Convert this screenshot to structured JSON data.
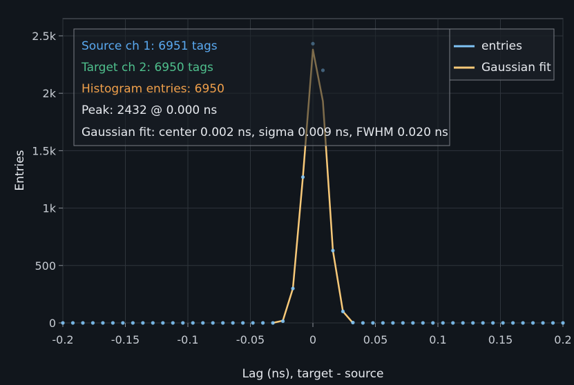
{
  "chart_data": {
    "type": "line",
    "title": "",
    "xlabel": "Lag (ns), target - source",
    "ylabel": "Entries",
    "xlim": [
      -0.2,
      0.2
    ],
    "ylim": [
      0,
      2650
    ],
    "grid": true,
    "x_ticks": [
      -0.2,
      -0.15,
      -0.1,
      -0.05,
      0,
      0.05,
      0.1,
      0.15,
      0.2
    ],
    "x_tick_labels": [
      "-0.2",
      "-0.15",
      "-0.1",
      "-0.05",
      "0",
      "0.05",
      "0.1",
      "0.15",
      "0.2"
    ],
    "y_ticks": [
      0,
      500,
      1000,
      1500,
      2000,
      2500
    ],
    "y_tick_labels": [
      "0",
      "500",
      "1k",
      "1.5k",
      "2k",
      "2.5k"
    ],
    "bin_width": 0.008,
    "series": [
      {
        "name": "entries",
        "color": "#7fc3f5",
        "style": "points",
        "x": [
          -0.2,
          -0.192,
          -0.184,
          -0.176,
          -0.168,
          -0.16,
          -0.152,
          -0.144,
          -0.136,
          -0.128,
          -0.12,
          -0.112,
          -0.104,
          -0.096,
          -0.088,
          -0.08,
          -0.072,
          -0.064,
          -0.056,
          -0.048,
          -0.04,
          -0.032,
          -0.024,
          -0.016,
          -0.008,
          0,
          0.008,
          0.016,
          0.024,
          0.032,
          0.04,
          0.048,
          0.056,
          0.064,
          0.072,
          0.08,
          0.088,
          0.096,
          0.104,
          0.112,
          0.12,
          0.128,
          0.136,
          0.144,
          0.152,
          0.16,
          0.168,
          0.176,
          0.184,
          0.192,
          0.2
        ],
        "y": [
          0,
          0,
          0,
          0,
          0,
          0,
          0,
          0,
          0,
          0,
          0,
          0,
          0,
          0,
          0,
          0,
          0,
          0,
          0,
          0,
          0,
          0,
          15,
          300,
          1270,
          2432,
          2200,
          630,
          100,
          3,
          0,
          0,
          0,
          0,
          0,
          0,
          0,
          0,
          0,
          0,
          0,
          0,
          0,
          0,
          0,
          0,
          0,
          0,
          0,
          0,
          0
        ]
      },
      {
        "name": "Gaussian fit",
        "color": "#f8c979",
        "style": "line",
        "x": [
          -0.032,
          -0.024,
          -0.016,
          -0.008,
          0,
          0.008,
          0.016,
          0.024,
          0.032
        ],
        "y": [
          0,
          20,
          300,
          1270,
          2380,
          1930,
          630,
          100,
          0
        ]
      }
    ],
    "annotations": [
      {
        "text": "Source ch 1: 6951 tags",
        "color": "#5aa9f0"
      },
      {
        "text": "Target ch 2: 6950 tags",
        "color": "#4fc08d"
      },
      {
        "text": "Histogram entries: 6950",
        "color": "#f0a04b"
      },
      {
        "text": "Peak: 2432 @ 0.000 ns",
        "color": "#e6e9ee"
      },
      {
        "text": "Gaussian fit: center 0.002 ns, sigma 0.009 ns, FWHM 0.020 ns",
        "color": "#e6e9ee"
      }
    ],
    "legend_position": "top-right"
  }
}
